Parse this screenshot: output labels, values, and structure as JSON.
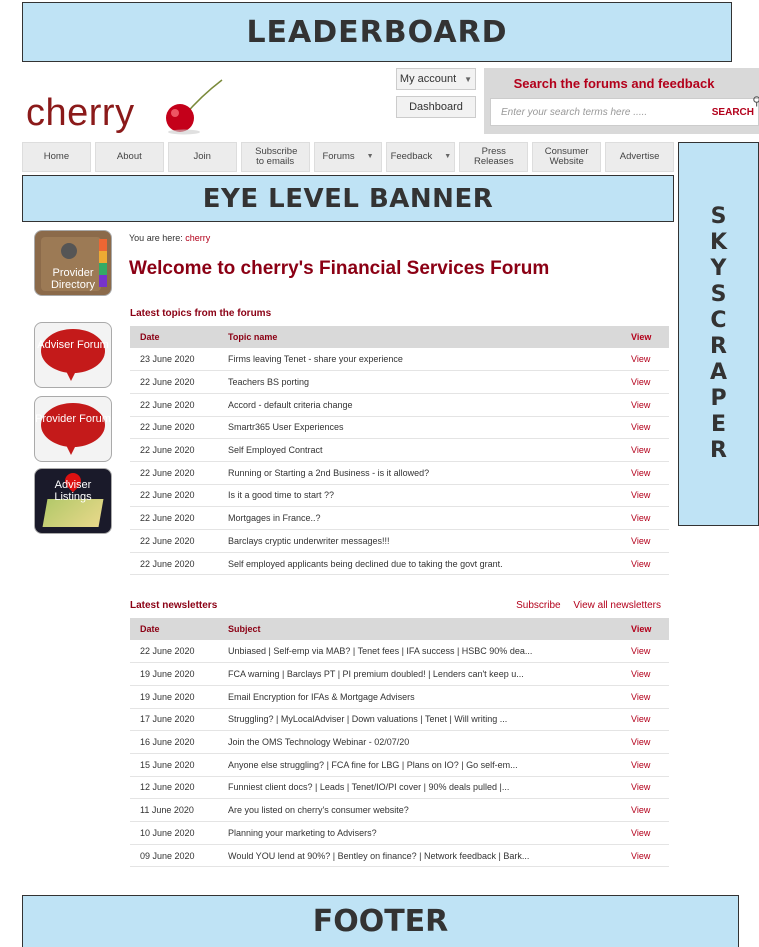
{
  "ads": {
    "leaderboard": "LEADERBOARD",
    "eye_level": "EYE LEVEL BANNER",
    "skyscraper_letters": [
      "S",
      "K",
      "Y",
      "S",
      "C",
      "R",
      "A",
      "P",
      "E",
      "R"
    ],
    "footer": "FOOTER"
  },
  "header": {
    "logo": "cherry",
    "my_account": "My account",
    "dashboard": "Dashboard",
    "search": {
      "title": "Search the forums and feedback",
      "placeholder": "Enter your search terms here .....",
      "button": "SEARCH"
    }
  },
  "nav": [
    {
      "label": "Home"
    },
    {
      "label": "About"
    },
    {
      "label": "Join"
    },
    {
      "label": "Subscribe to emails"
    },
    {
      "label": "Forums",
      "dropdown": true
    },
    {
      "label": "Feedback",
      "dropdown": true
    },
    {
      "label": "Press Releases"
    },
    {
      "label": "Consumer Website"
    },
    {
      "label": "Advertise"
    }
  ],
  "side_icons": {
    "provider_directory": "Provider Directory",
    "adviser_forum": "Adviser Forum",
    "provider_forum": "Provider Forum",
    "adviser_listings": "Adviser Listings"
  },
  "main": {
    "breadcrumb_prefix": "You are here:",
    "breadcrumb_link": "cherry",
    "title": "Welcome to cherry's Financial Services Forum",
    "topics": {
      "title": "Latest topics from the forums",
      "headers": [
        "Date",
        "Topic name",
        "View"
      ],
      "rows": [
        [
          "23 June 2020",
          "Firms leaving Tenet - share your experience",
          "View"
        ],
        [
          "22 June 2020",
          "Teachers BS porting",
          "View"
        ],
        [
          "22 June 2020",
          "Accord - default criteria change",
          "View"
        ],
        [
          "22 June 2020",
          "Smartr365 User Experiences",
          "View"
        ],
        [
          "22 June 2020",
          "Self Employed Contract",
          "View"
        ],
        [
          "22 June 2020",
          "Running or Starting a 2nd Business - is it allowed?",
          "View"
        ],
        [
          "22 June 2020",
          "Is it a good time to start ??",
          "View"
        ],
        [
          "22 June 2020",
          "Mortgages in France..?",
          "View"
        ],
        [
          "22 June 2020",
          "Barclays cryptic underwriter messages!!!",
          "View"
        ],
        [
          "22 June 2020",
          "Self employed applicants being declined due to taking the govt grant.",
          "View"
        ]
      ]
    },
    "newsletters": {
      "title": "Latest newsletters",
      "subscribe": "Subscribe",
      "view_all": "View all newsletters",
      "headers": [
        "Date",
        "Subject",
        "View"
      ],
      "rows": [
        [
          "22 June 2020",
          "Unbiased | Self-emp via MAB? | Tenet fees | IFA success | HSBC 90% dea...",
          "View"
        ],
        [
          "19 June 2020",
          "FCA warning | Barclays PT | PI premium doubled! | Lenders can't keep u...",
          "View"
        ],
        [
          "19 June 2020",
          "Email Encryption for IFAs & Mortgage Advisers",
          "View"
        ],
        [
          "17 June 2020",
          "Struggling? | MyLocalAdviser | Down valuations | Tenet | Will writing ...",
          "View"
        ],
        [
          "16 June 2020",
          "Join the OMS Technology Webinar - 02/07/20",
          "View"
        ],
        [
          "15 June 2020",
          "Anyone else struggling? | FCA fine for LBG | Plans on IO? | Go self-em...",
          "View"
        ],
        [
          "12 June 2020",
          "Funniest client docs? | Leads | Tenet/IO/PI cover | 90% deals pulled |...",
          "View"
        ],
        [
          "11 June 2020",
          "Are you listed on cherry's consumer website?",
          "View"
        ],
        [
          "10 June 2020",
          "Planning your marketing to Advisers?",
          "View"
        ],
        [
          "09 June 2020",
          "Would YOU lend at 90%? | Bentley on finance? | Network feedback | Bark...",
          "View"
        ]
      ]
    }
  }
}
